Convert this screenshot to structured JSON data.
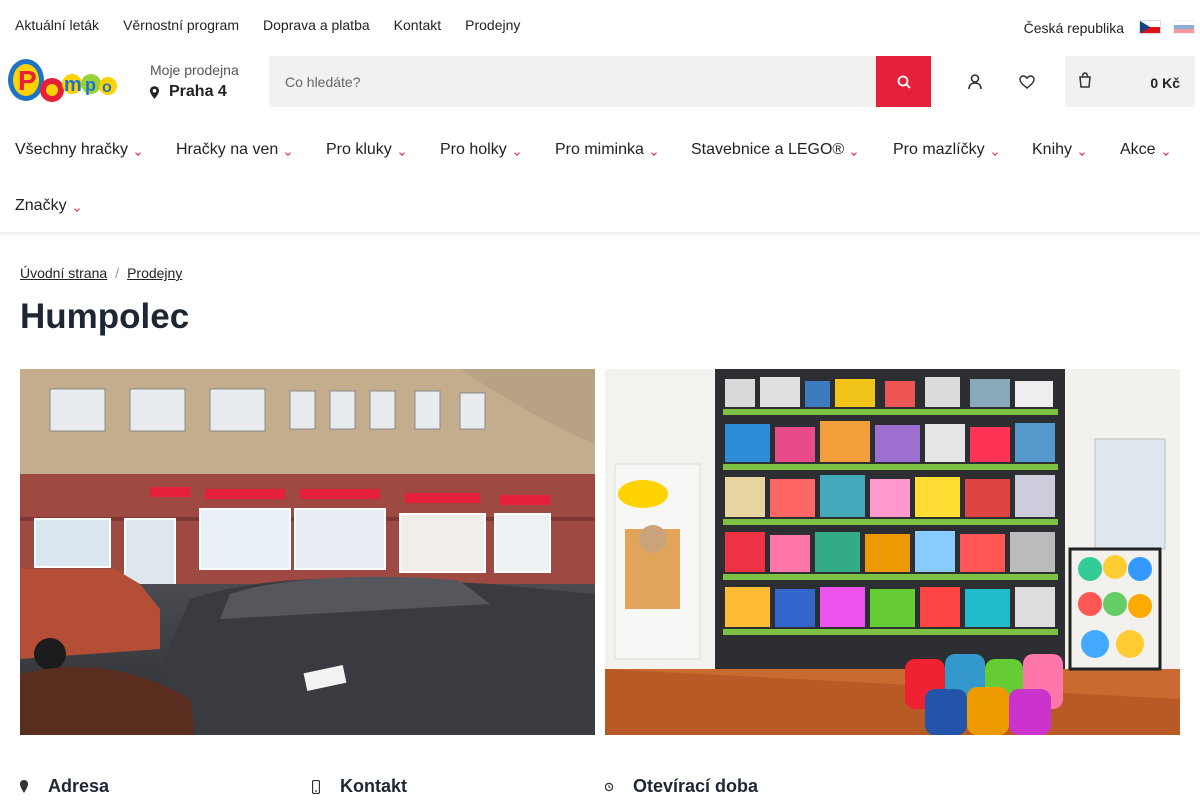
{
  "topbar": {
    "links": [
      "Aktuální leták",
      "Věrnostní program",
      "Doprava a platba",
      "Kontakt",
      "Prodejny"
    ],
    "country": "Česká republika"
  },
  "header": {
    "logo_text": "Pompo",
    "store_label": "Moje prodejna",
    "store_value": "Praha 4",
    "search_placeholder": "Co hledáte?",
    "cart_total": "0 Kč"
  },
  "nav": {
    "items": [
      "Všechny hračky",
      "Hračky na ven",
      "Pro kluky",
      "Pro holky",
      "Pro miminka",
      "Stavebnice a LEGO®",
      "Pro mazlíčky",
      "Knihy",
      "Akce",
      "Značky"
    ]
  },
  "breadcrumb": {
    "home": "Úvodní strana",
    "stores": "Prodejny",
    "separator": "/"
  },
  "page": {
    "title": "Humpolec"
  },
  "info": {
    "address": "Adresa",
    "contact": "Kontakt",
    "hours": "Otevírací doba"
  },
  "colors": {
    "accent": "#e6203a",
    "title": "#1d2733",
    "search_bg": "#f1f1f1"
  },
  "icons": {
    "search": "search-icon",
    "account": "user-icon",
    "wishlist": "heart-icon",
    "cart": "cart-icon",
    "store": "map-pin-icon"
  }
}
